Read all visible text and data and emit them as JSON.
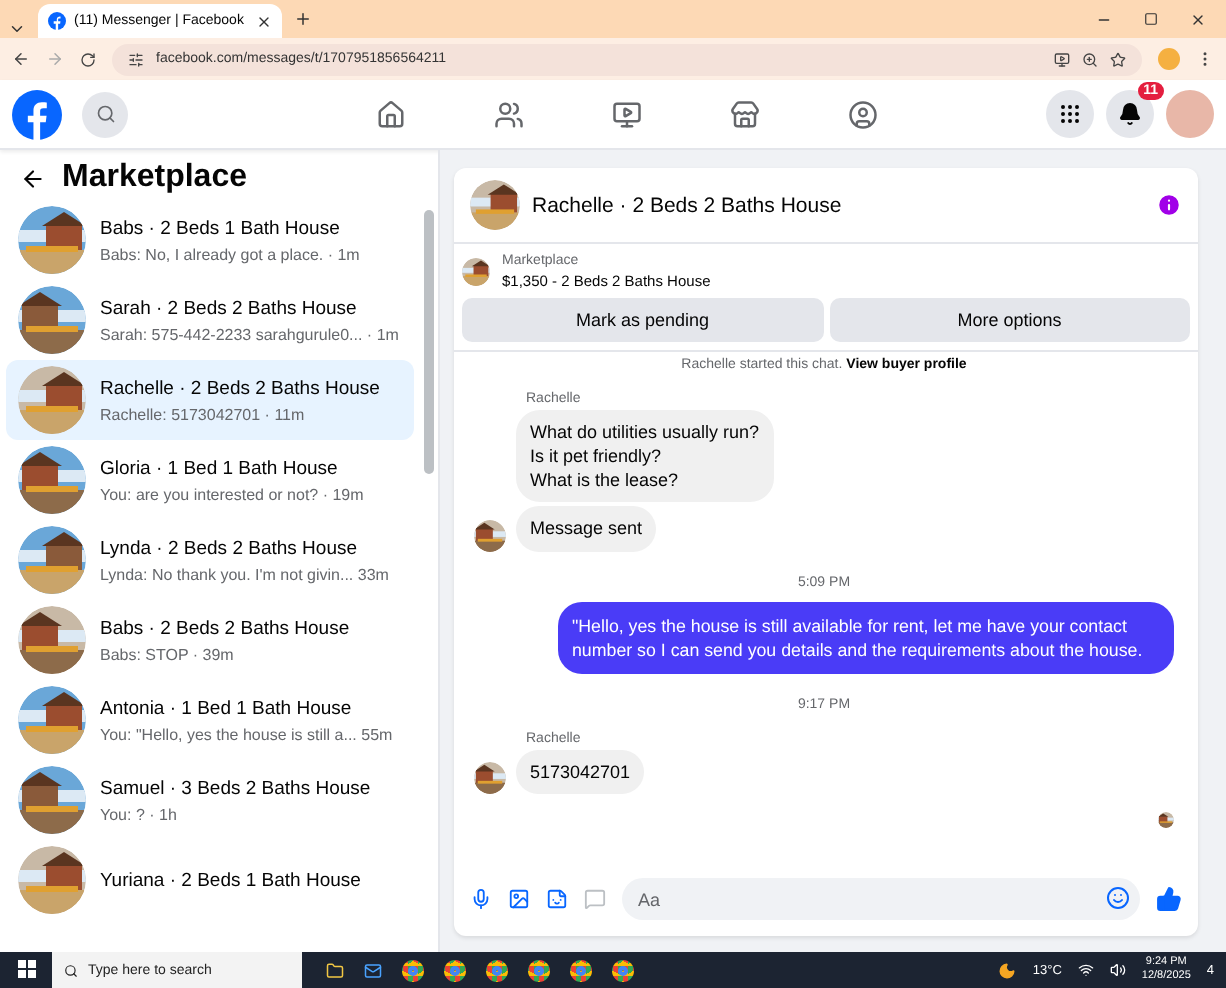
{
  "browser": {
    "tab_title": "(11) Messenger | Facebook",
    "url": "facebook.com/messages/t/1707951856564211"
  },
  "nav": {
    "notifications_badge": "11"
  },
  "sidebar": {
    "title": "Marketplace",
    "conversations": [
      {
        "title": "Babs · 2 Beds 1 Bath House",
        "preview": "Babs: No, I already got a place.",
        "time": "· 1m",
        "selected": false
      },
      {
        "title": "Sarah · 2 Beds 2 Baths House",
        "preview": "Sarah: 575-442-2233 sarahgurule0...",
        "time": "· 1m",
        "selected": false
      },
      {
        "title": "Rachelle · 2 Beds 2 Baths House",
        "preview": "Rachelle: 5173042701",
        "time": "· 11m",
        "selected": true
      },
      {
        "title": "Gloria · 1 Bed 1 Bath House",
        "preview": "You: are you interested or not?",
        "time": "· 19m",
        "selected": false
      },
      {
        "title": "Lynda · 2 Beds 2 Baths House",
        "preview": "Lynda: No thank you. I'm not givin...",
        "time": "33m",
        "selected": false
      },
      {
        "title": "Babs · 2 Beds 2 Baths House",
        "preview": "Babs: STOP",
        "time": "· 39m",
        "selected": false
      },
      {
        "title": "Antonia · 1 Bed 1 Bath House",
        "preview": "You: \"Hello, yes the house is still a...",
        "time": "55m",
        "selected": false
      },
      {
        "title": "Samuel · 3 Beds 2 Baths House",
        "preview": "You: ?",
        "time": "· 1h",
        "selected": false
      },
      {
        "title": "Yuriana · 2 Beds 1 Bath House",
        "selected": false
      }
    ]
  },
  "chat": {
    "title": "Rachelle · 2 Beds 2 Baths House",
    "listing": {
      "label": "Marketplace",
      "detail": "$1,350 - 2 Beds 2 Baths House"
    },
    "actions": [
      "Mark as pending",
      "More options"
    ],
    "messages": [
      {
        "kind": "system",
        "text": "Rachelle started this chat.",
        "link": "View buyer profile"
      },
      {
        "kind": "incoming",
        "sender": "Rachelle",
        "bubbles": [
          [
            "What do utilities usually run?",
            "Is it pet friendly?",
            "What is the lease?"
          ],
          [
            "Message sent"
          ]
        ]
      },
      {
        "kind": "timestamp",
        "text": "5:09 PM"
      },
      {
        "kind": "outgoing",
        "text": "\"Hello, yes the house is still available for rent, let me have your contact number so I can send you details and the requirements about the house."
      },
      {
        "kind": "timestamp",
        "text": "9:17 PM"
      },
      {
        "kind": "incoming",
        "sender": "Rachelle",
        "bubbles": [
          [
            "5173042701"
          ]
        ]
      }
    ],
    "composer": {
      "placeholder": "Aa"
    }
  },
  "taskbar": {
    "search_placeholder": "Type here to search",
    "weather": "13°C",
    "time": "9:24 PM",
    "date": "12/8/2025",
    "notifications": "4"
  }
}
